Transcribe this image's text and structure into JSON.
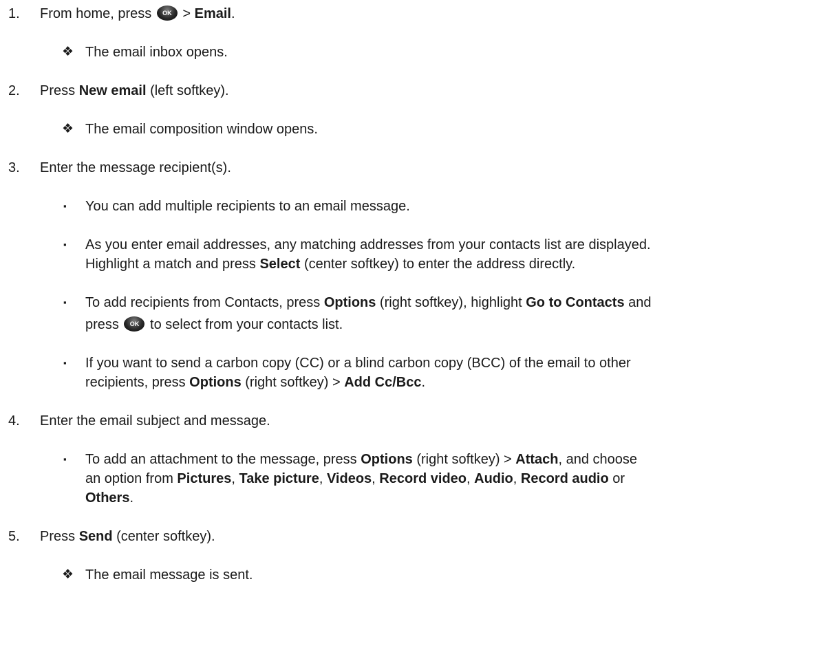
{
  "steps": {
    "s1": {
      "num": "1.",
      "pre": "From home, press",
      "ok": "OK",
      "mid": " > ",
      "b1": "Email",
      "end": "."
    },
    "s1_note": {
      "mark": "❖",
      "text": "The email inbox opens."
    },
    "s2": {
      "num": "2.",
      "pre": "Press ",
      "b1": "New email",
      "end": " (left softkey)."
    },
    "s2_note": {
      "mark": "❖",
      "text": "The email composition window opens."
    },
    "s3": {
      "num": "3.",
      "text": "Enter the message recipient(s)."
    },
    "s3_b1": {
      "mark": "▪",
      "text": "You can add multiple recipients to an email message."
    },
    "s3_b2": {
      "mark": "▪",
      "l1": "As you enter email addresses, any matching addresses from your contacts list are displayed.",
      "l2_pre": "Highlight a match and press ",
      "l2_b": "Select",
      "l2_end": " (center softkey) to enter the address directly."
    },
    "s3_b3": {
      "mark": "▪",
      "pre": "To add recipients from Contacts, press ",
      "b1": "Options",
      "mid": " (right softkey), highlight ",
      "b2": "Go to Contacts",
      "end": " and",
      "l2_pre": "press",
      "ok": "OK",
      "l2_end": " to select from your contacts list."
    },
    "s3_b4": {
      "mark": "▪",
      "l1": "If you want to send a carbon copy (CC) or a blind carbon copy (BCC) of the email to other",
      "l2_pre": "recipients, press ",
      "l2_b1": "Options",
      "l2_mid": " (right softkey) > ",
      "l2_b2": "Add Cc/Bcc",
      "l2_end": "."
    },
    "s4": {
      "num": "4.",
      "text": "Enter the email subject and message."
    },
    "s4_b1": {
      "mark": "▪",
      "pre": "To add an attachment to the message, press ",
      "b1": "Options",
      "mid": " (right softkey) > ",
      "b2": "Attach",
      "end": ", and choose",
      "l2_pre": "an option from ",
      "o1": "Pictures",
      "c1": ", ",
      "o2": "Take picture",
      "c2": ", ",
      "o3": "Videos",
      "c3": ", ",
      "o4": "Record video",
      "c4": ", ",
      "o5": "Audio",
      "c5": ", ",
      "o6": "Record audio",
      "c6": " or",
      "l3_b": "Others",
      "l3_end": "."
    },
    "s5": {
      "num": "5.",
      "pre": "Press ",
      "b1": "Send",
      "end": " (center softkey)."
    },
    "s5_note": {
      "mark": "❖",
      "text": "The email message is sent."
    }
  }
}
